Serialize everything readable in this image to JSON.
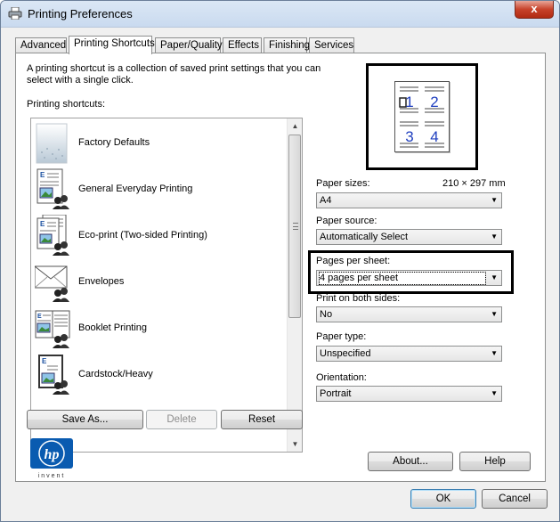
{
  "window": {
    "title": "Printing Preferences",
    "close_glyph": "x"
  },
  "tabs": [
    {
      "label": "Advanced"
    },
    {
      "label": "Printing Shortcuts"
    },
    {
      "label": "Paper/Quality"
    },
    {
      "label": "Effects"
    },
    {
      "label": "Finishing"
    },
    {
      "label": "Services"
    }
  ],
  "shortcuts": {
    "intro": "A printing shortcut is a collection of saved print settings that you can select with a single click.",
    "label": "Printing shortcuts:",
    "items": [
      {
        "label": "Factory Defaults",
        "icon": "factory-defaults-icon"
      },
      {
        "label": "General Everyday Printing",
        "icon": "general-printing-icon"
      },
      {
        "label": "Eco-print (Two-sided Printing)",
        "icon": "eco-print-icon"
      },
      {
        "label": "Envelopes",
        "icon": "envelope-icon"
      },
      {
        "label": "Booklet Printing",
        "icon": "booklet-icon"
      },
      {
        "label": "Cardstock/Heavy",
        "icon": "cardstock-icon"
      }
    ],
    "buttons": {
      "save_as": "Save As...",
      "delete": "Delete",
      "reset": "Reset"
    }
  },
  "preview": {
    "pages": [
      "1",
      "2",
      "3",
      "4"
    ]
  },
  "settings": {
    "paper_size": {
      "label": "Paper sizes:",
      "value": "A4",
      "dimensions": "210 × 297 mm"
    },
    "paper_source": {
      "label": "Paper source:",
      "value": "Automatically Select"
    },
    "pages_per_sheet": {
      "label": "Pages per sheet:",
      "value": "4 pages per sheet"
    },
    "print_both_sides": {
      "label": "Print on both sides:",
      "value": "No"
    },
    "paper_type": {
      "label": "Paper type:",
      "value": "Unspecified"
    },
    "orientation": {
      "label": "Orientation:",
      "value": "Portrait"
    }
  },
  "brand": {
    "logo_text": "hp",
    "tagline": "invent",
    "color": "#0a5bb0"
  },
  "panel_buttons": {
    "about": "About...",
    "help": "Help"
  },
  "dialog_buttons": {
    "ok": "OK",
    "cancel": "Cancel"
  },
  "colors": {
    "preview_number": "#1f3fbf",
    "close_button": "#c7422a"
  }
}
